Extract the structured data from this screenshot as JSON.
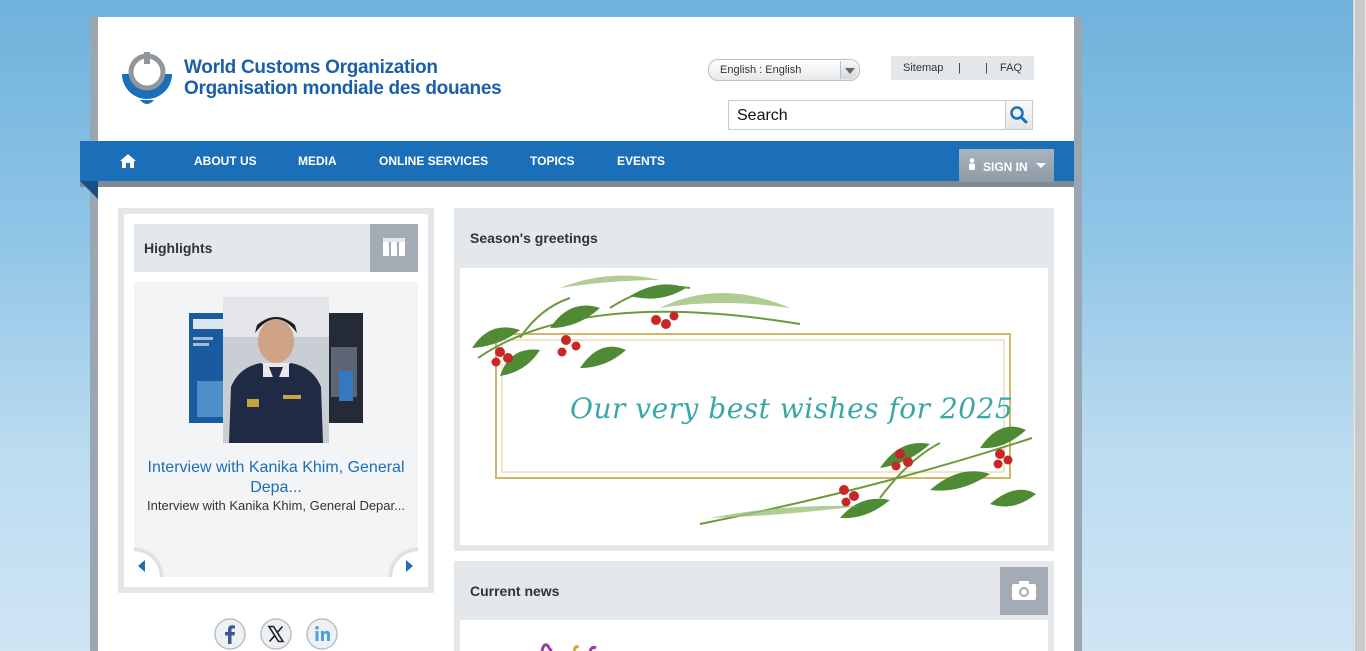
{
  "logo": {
    "line1": "World Customs Organization",
    "line2": "Organisation mondiale des douanes",
    "color": "#1b5fab"
  },
  "language": {
    "selected": "English : English"
  },
  "toplinks": {
    "sitemap": "Sitemap",
    "sep1": "|",
    "sep2": "|",
    "faq": "FAQ"
  },
  "search": {
    "value": "Search"
  },
  "nav": {
    "items": [
      "ABOUT US",
      "MEDIA",
      "ONLINE SERVICES",
      "TOPICS",
      "EVENTS"
    ],
    "signin": "SIGN IN",
    "color": "#1b6fb9"
  },
  "highlights": {
    "title": "Highlights",
    "link": "Interview with Kanika Khim, General Depa...",
    "sub": "Interview with Kanika Khim, General Depar..."
  },
  "season": {
    "title": "Season's greetings",
    "message": "Our very best wishes for 2025"
  },
  "news": {
    "title": "Current news"
  },
  "icons": [
    "home-icon",
    "search-icon",
    "person-icon",
    "grid-icon",
    "camera-icon",
    "facebook-icon",
    "x-icon",
    "linkedin-icon",
    "chevron-left-icon",
    "chevron-right-icon"
  ]
}
